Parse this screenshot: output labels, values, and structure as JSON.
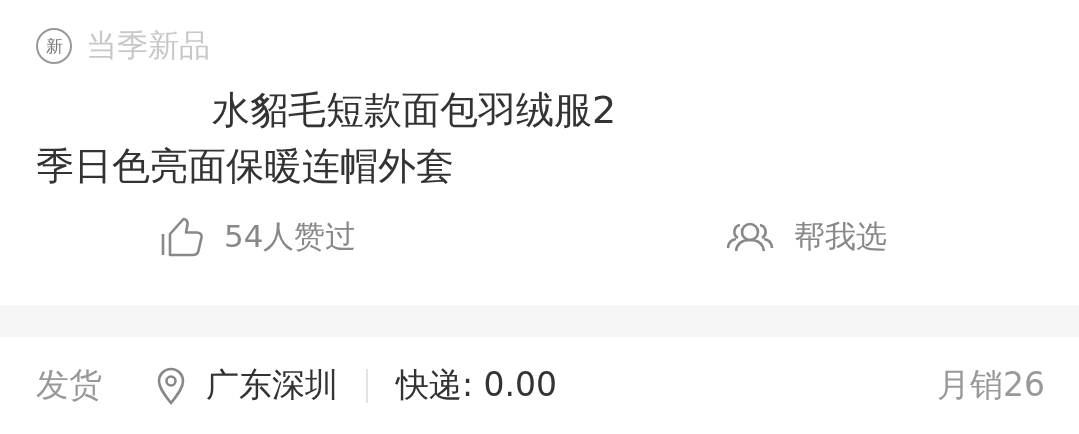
{
  "badge": {
    "icon": "新",
    "label": "当季新品"
  },
  "title_lines": [
    "水貂毛短款面包羽绒服2",
    "季日色亮面保暖连帽外套"
  ],
  "actions": [
    {
      "kind": "like",
      "label": "54人赞过"
    },
    {
      "kind": "people",
      "label": "帮我选"
    }
  ],
  "shipping": {
    "label": "发货",
    "location": "广东深圳",
    "express": "快递: 0.00",
    "monthly_sales": "月销26"
  }
}
